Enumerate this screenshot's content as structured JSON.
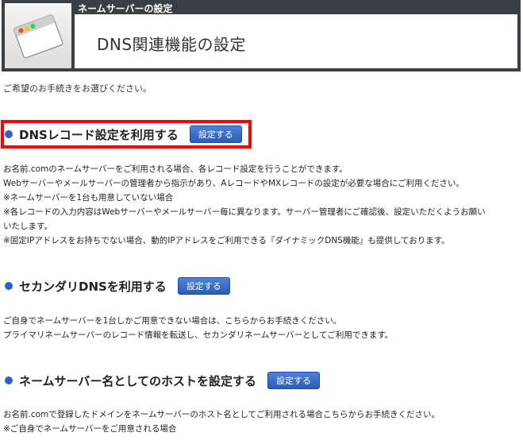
{
  "header": {
    "small_title": "ネームサーバーの設定",
    "title": "DNS関連機能の設定",
    "icon": "window-icon"
  },
  "intro": "ご希望のお手続きをお選びください。",
  "sections": [
    {
      "heading": "DNSレコード設定を利用する",
      "button": "設定する",
      "lines": [
        "お名前.comのネームサーバーをご利用される場合、各レコード設定を行うことができます。",
        "Webサーバーやメールサーバーの管理者から指示があり、AレコードやMXレコードの設定が必要な場合にご利用ください。",
        "※ネームサーバーを1台も用意していない場合",
        "※各レコードの入力内容はWebサーバーやメールサーバー毎に異なります。サーバー管理者にご確認後、設定いただくようお願い",
        "いたします。",
        "※固定IPアドレスをお持ちでない場合、動的IPアドレスをご利用できる『ダイナミックDNS機能』も提供しております。"
      ]
    },
    {
      "heading": "セカンダリDNSを利用する",
      "button": "設定する",
      "lines": [
        "ご自身でネームサーバーを1台しかご用意できない場合は、こちらからお手続きください。",
        "プライマリネームサーバーのレコード情報を転送し、セカンダリネームサーバーとしてご利用できます。"
      ]
    },
    {
      "heading": "ネームサーバー名としてのホストを設定する",
      "button": "設定する",
      "lines": [
        "お名前.comで登録したドメインをネームサーバーのホスト名としてご利用される場合こちらからお手続きください。",
        "※ご自身でネームサーバーをご用意される場合"
      ]
    }
  ],
  "colors": {
    "header_bg": "#3a3f45",
    "bullet": "#2f5fc4",
    "button": "#2a5db8",
    "highlight": "#ff0000"
  }
}
